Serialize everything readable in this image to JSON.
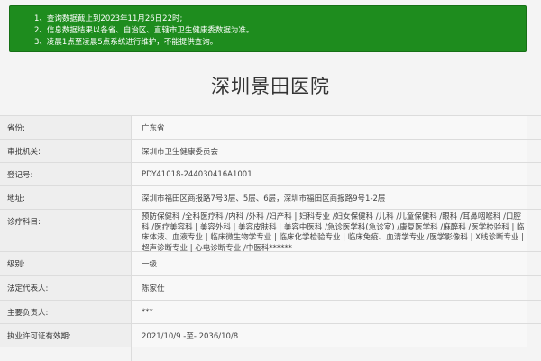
{
  "notice": {
    "items": [
      "1、查询数据截止到2023年11月26日22时;",
      "2、信息数据结果以各省、自治区、直辖市卫生健康委数据为准。",
      "3、凌晨1点至凌晨5点系统进行维护，不能提供查询。"
    ],
    "bg_color": "#1e8c1e"
  },
  "hospital": {
    "name": "深圳景田医院"
  },
  "fields": [
    {
      "label": "省份:",
      "value": "广东省"
    },
    {
      "label": "审批机关:",
      "value": "深圳市卫生健康委员会"
    },
    {
      "label": "登记号:",
      "value": "PDY41018-244030416A1001"
    },
    {
      "label": "地址:",
      "value": "深圳市福田区商报路7号3层、5层、6层，深圳市福田区商报路9号1-2层"
    },
    {
      "label": "诊疗科目:",
      "value": "预防保健科 /全科医疗科 /内科 /外科 /妇产科 | 妇科专业 /妇女保健科 /儿科 /儿童保健科 /眼科 /耳鼻咽喉科 /口腔科 /医疗美容科 | 美容外科 | 美容皮肤科 | 美容中医科 /急诊医学科(急诊室) /康复医学科 /麻醉科 /医学检验科 | 临床体液、血液专业 | 临床微生物学专业 | 临床化学检验专业 | 临床免疫、血清学专业 /医学影像科 | X线诊断专业 | 超声诊断专业 | 心电诊断专业 /中医科******"
    },
    {
      "label": "级别:",
      "value": "一级"
    },
    {
      "label": "法定代表人:",
      "value": "陈家仕"
    },
    {
      "label": "主要负责人:",
      "value": "***"
    },
    {
      "label": "执业许可证有效期:",
      "value": "2021/10/9 -至- 2036/10/8"
    }
  ]
}
